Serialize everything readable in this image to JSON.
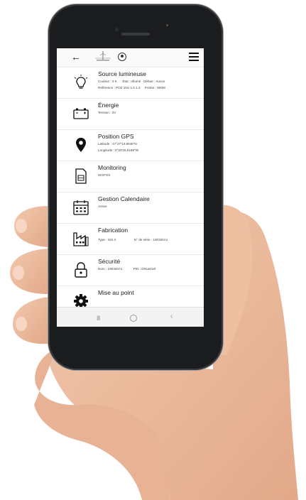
{
  "colors": {
    "icon": "#111111",
    "accent": "#e5e5e5"
  },
  "appbar": {
    "back_icon": "arrow-left-icon",
    "user_icon": "user-circle-icon",
    "menu_icon": "hamburger-icon"
  },
  "rows": [
    {
      "icon": "lightbulb-icon",
      "title": "Source lumineuse",
      "lines": [
        "Couleur : 4 K      État : Allumé   Défaut : Aucun",
        "Référence : POZ 10U 1.0.1.3     Portée : 800M"
      ]
    },
    {
      "icon": "battery-icon",
      "title": "Énergie",
      "lines": [
        "Tension : 3V"
      ]
    },
    {
      "icon": "map-pin-icon",
      "title": "Position GPS",
      "lines": [
        "Latitude : 47°27'13.8046\"N",
        "Longitude : 0°33'26.8168\"W"
      ]
    },
    {
      "icon": "sim-card-icon",
      "title": "Monitoring",
      "lines": [
        "SIGFOX"
      ]
    },
    {
      "icon": "calendar-icon",
      "title": "Gestion Calendaire",
      "lines": [
        "Active"
      ]
    },
    {
      "icon": "factory-icon",
      "title": "Fabrication",
      "lines": [
        "Type : SIS-2                    N° de série : 190320A1"
      ]
    },
    {
      "icon": "lock-icon",
      "title": "Sécurité",
      "lines": [
        "Nom : 190320A1            PIN : Désactivé"
      ]
    },
    {
      "icon": "gear-icon",
      "title": "Mise au point",
      "lines": []
    }
  ],
  "navbar": {
    "recent": "III",
    "home": "home-circle-icon",
    "back": "‹"
  }
}
